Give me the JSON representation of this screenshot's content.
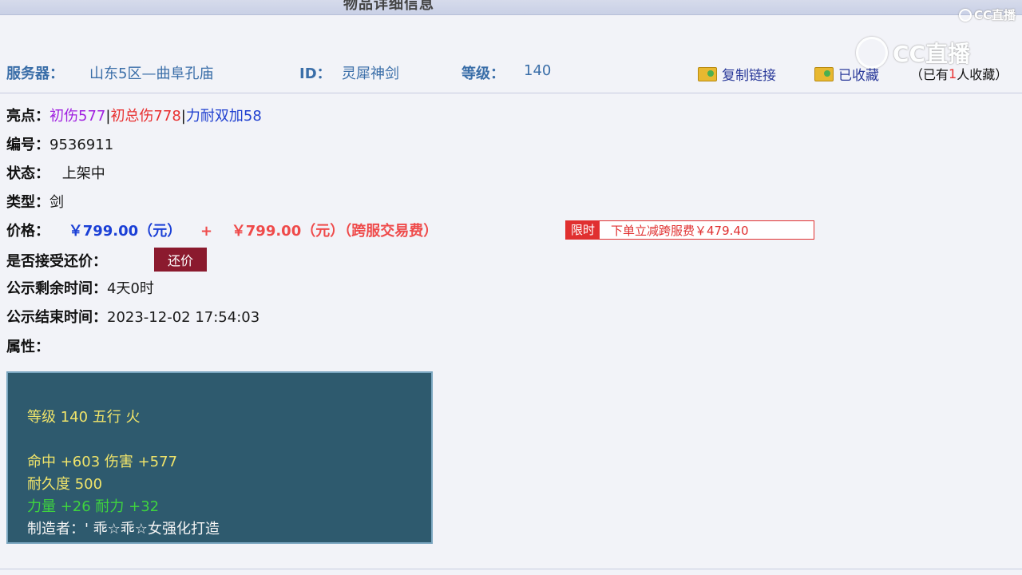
{
  "header": {
    "title": "物品详细信息"
  },
  "watermark": {
    "small": "CC直播",
    "big": "CC直播"
  },
  "info": {
    "server_label": "服务器：",
    "server_value": "山东5区—曲阜孔庙",
    "id_label": "ID：",
    "id_value": "灵犀神剑",
    "level_label": "等级：",
    "level_value": "140"
  },
  "actions": {
    "copy_link": "复制链接",
    "favorited": "已收藏",
    "fav_count_prefix": "（已有",
    "fav_count": "1",
    "fav_count_suffix": "人收藏）"
  },
  "details": {
    "highlights_label": "亮点：",
    "highlights": [
      "初伤577",
      "初总伤778",
      "力耐双加58"
    ],
    "highlight_colors": [
      "#a020e0",
      "#e83030",
      "#2040d0"
    ],
    "serial_label": "编号：",
    "serial_value": "9536911",
    "status_label": "状态：",
    "status_value": "上架中",
    "type_label": "类型：",
    "type_value": "剑",
    "price_label": "价格：",
    "price_value": "￥799.00（元）",
    "price_plus": "+",
    "fee_value": "￥799.00（元）（跨服交易费）",
    "promo_tag": "限时",
    "promo_text": "下单立减跨服费￥479.40",
    "haggle_label": "是否接受还价：",
    "haggle_button": "还价",
    "remaining_label": "公示剩余时间：",
    "remaining_value": "4天0时",
    "end_label": "公示结束时间：",
    "end_value": "2023-12-02 17:54:03",
    "attr_label": "属性："
  },
  "attributes": {
    "line1": "等级 140 五行 火",
    "line2": "命中 +603 伤害 +577",
    "line3": "耐久度 500",
    "line4": "力量 +26 耐力 +32",
    "line5": "制造者：' 乖☆乖☆女强化打造"
  }
}
